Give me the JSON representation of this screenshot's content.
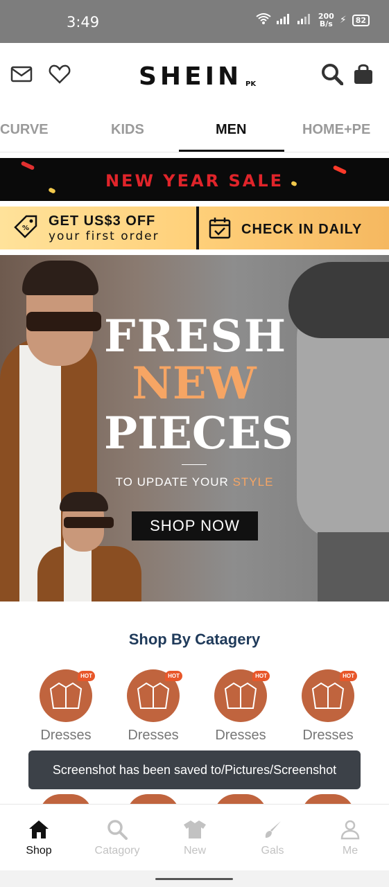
{
  "status_bar": {
    "time": "3:49",
    "net_speed_value": "200",
    "net_speed_unit": "B/s",
    "battery": "82"
  },
  "header": {
    "logo": "SHEIN",
    "logo_suffix": "PK"
  },
  "tabs": [
    {
      "label": "CURVE"
    },
    {
      "label": "KIDS"
    },
    {
      "label": "MEN",
      "active": true
    },
    {
      "label": "HOME+PE"
    }
  ],
  "banner": {
    "text": "NEW YEAR SALE"
  },
  "promo": {
    "title": "GET US$3 OFF",
    "subtitle": "your first order",
    "checkin": "CHECK IN DAILY"
  },
  "hero": {
    "line1": "FRESH",
    "line2": "NEW",
    "line3": "PIECES",
    "tagline_prefix": "TO UPDATE YOUR ",
    "tagline_highlight": "STYLE",
    "cta": "SHOP NOW"
  },
  "category": {
    "title": "Shop By Catagery",
    "badge": "HOT",
    "items": [
      {
        "label": "Dresses"
      },
      {
        "label": "Dresses"
      },
      {
        "label": "Dresses"
      },
      {
        "label": "Dresses"
      }
    ]
  },
  "toast": {
    "text": "Screenshot has been saved to/Pictures/Screenshot"
  },
  "bottom_nav": [
    {
      "label": "Shop",
      "icon": "home-icon",
      "active": true
    },
    {
      "label": "Catagory",
      "icon": "search-icon"
    },
    {
      "label": "New",
      "icon": "shirt-icon"
    },
    {
      "label": "Gals",
      "icon": "brush-icon"
    },
    {
      "label": "Me",
      "icon": "user-icon"
    }
  ],
  "colors": {
    "accent_orange": "#f6a564",
    "category_circle": "#c0643e",
    "title_blue": "#1f3a5a",
    "banner_red": "#e0242a"
  }
}
